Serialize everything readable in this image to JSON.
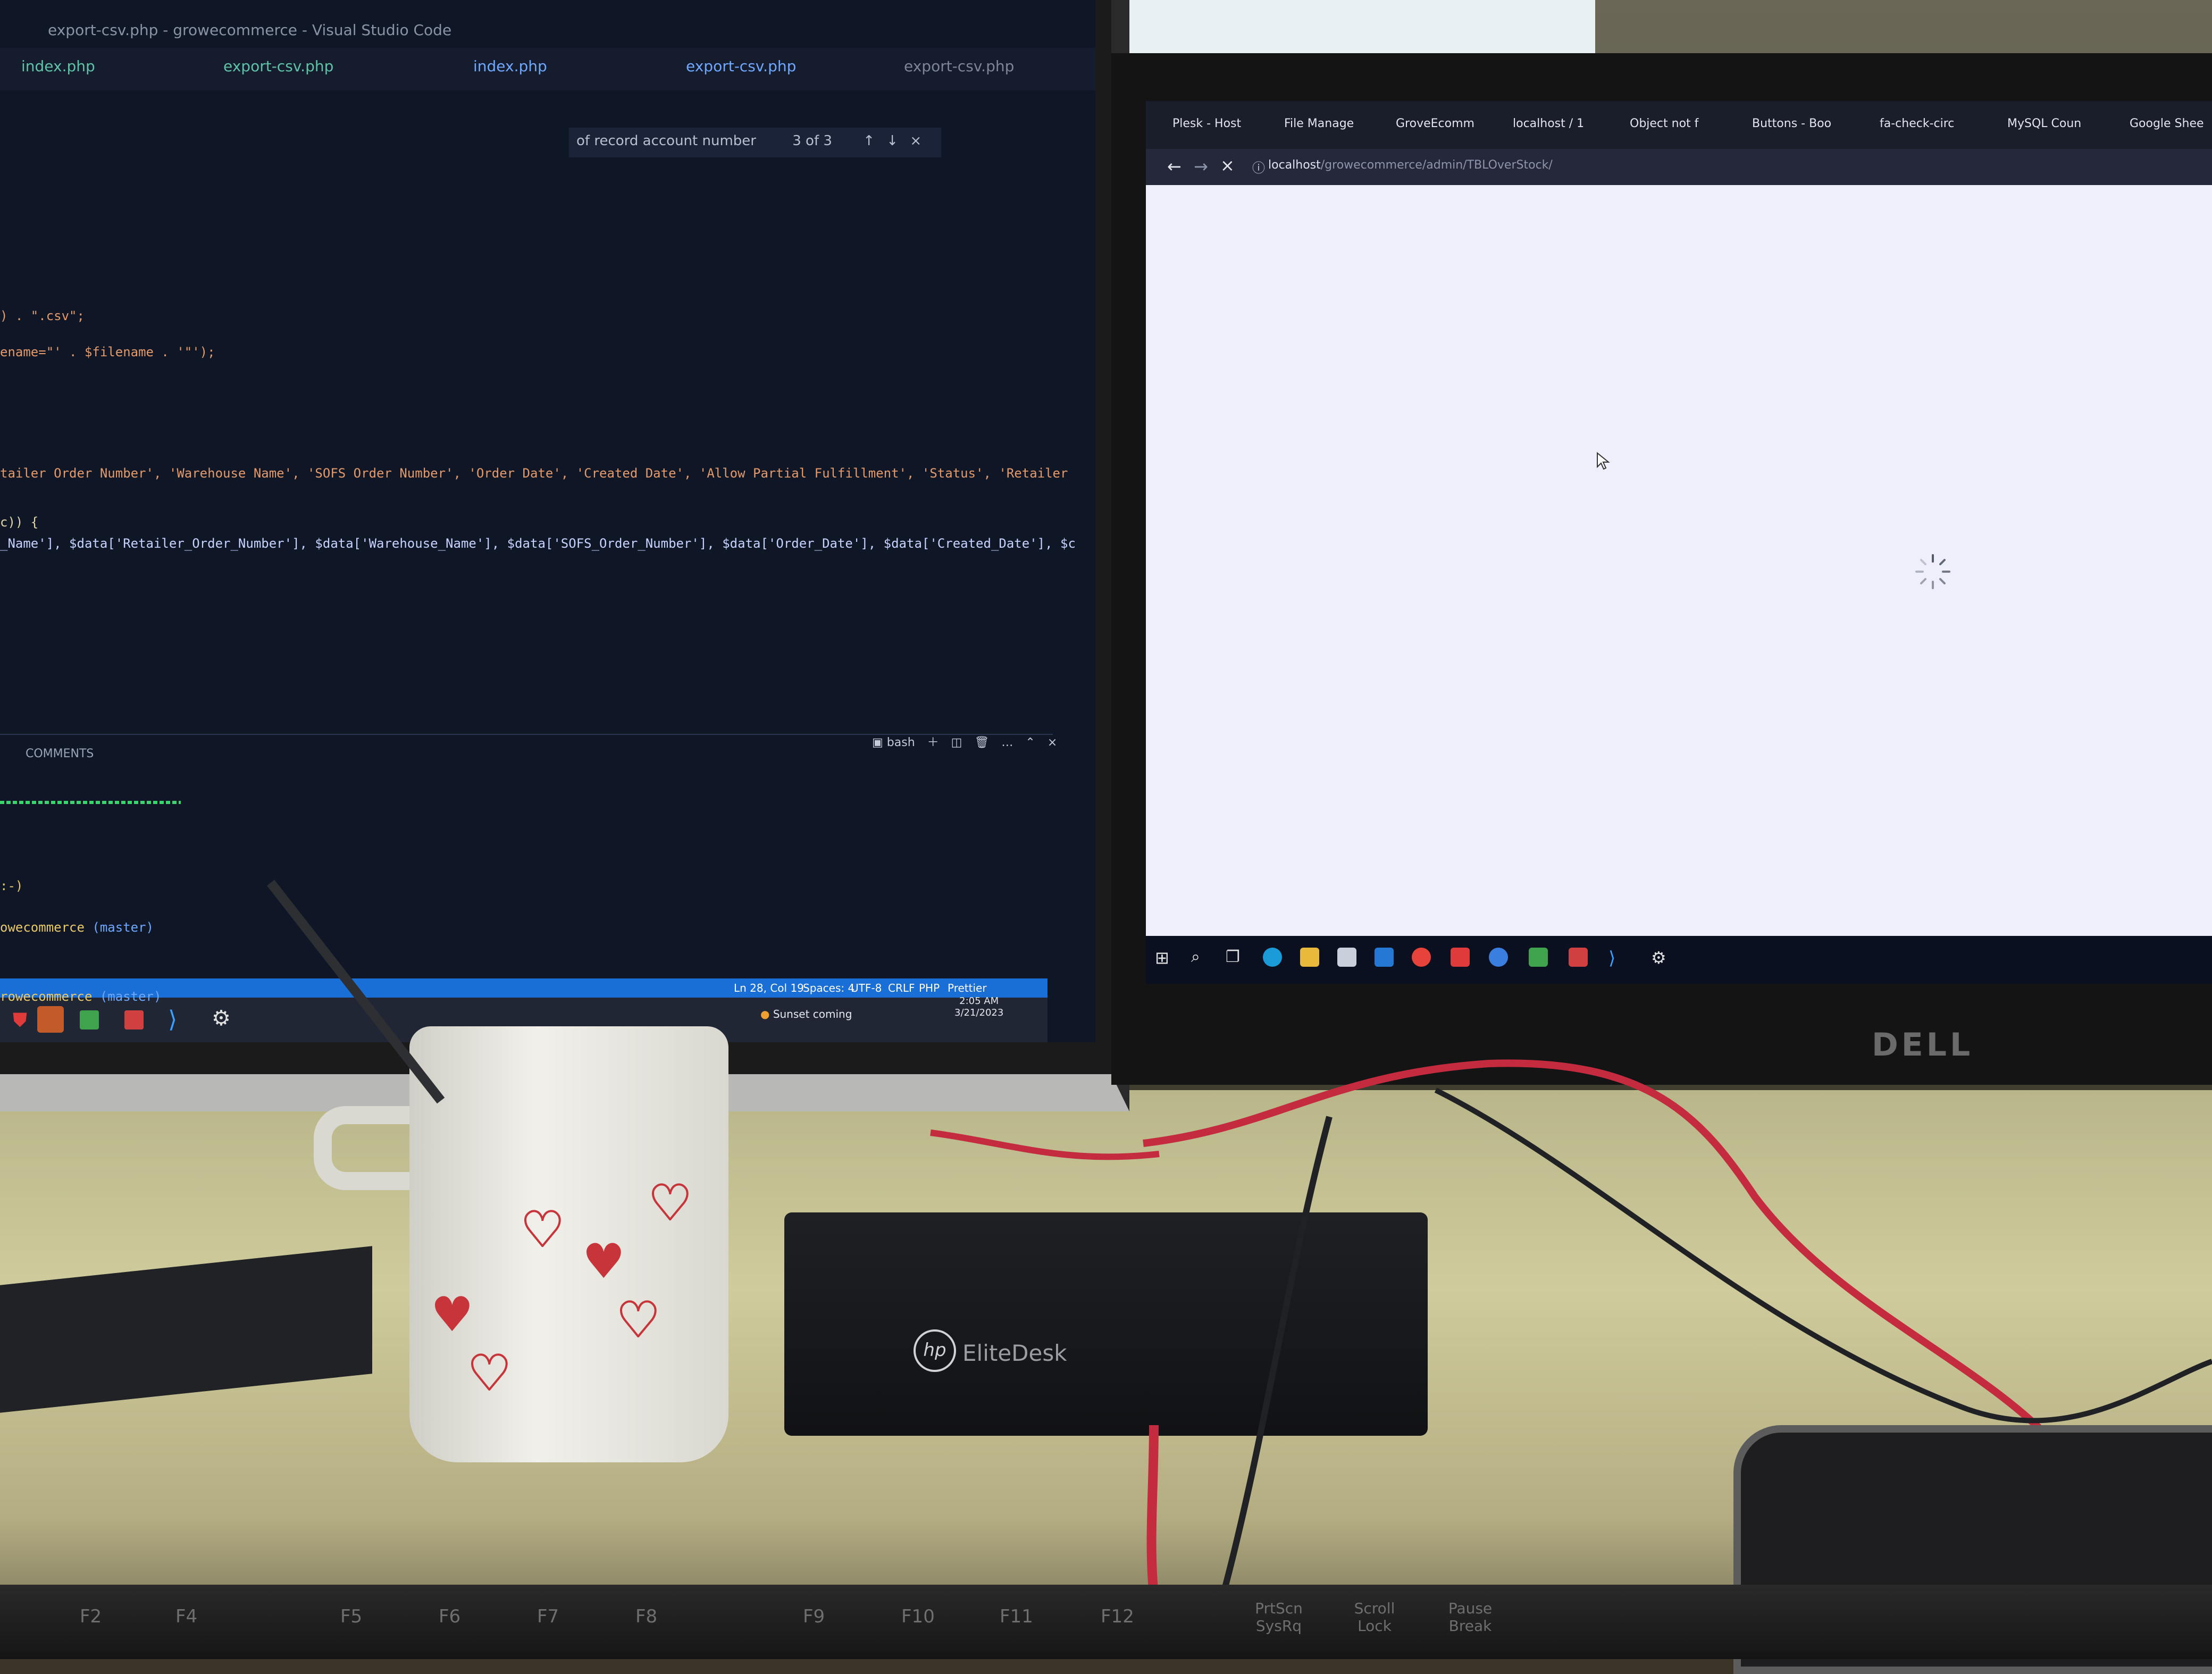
{
  "editor": {
    "title": "export-csv.php - growecommerce - Visual Studio Code",
    "tabs": [
      "index.php",
      "export-csv.php",
      "index.php",
      "export-csv.php",
      "export-csv.php"
    ],
    "find": {
      "query": "of record account number",
      "match": "3 of 3"
    },
    "code_lines": [
      ") . \".csv\";",
      "ename=\"' . $filename . '\"');",
      "tailer Order Number', 'Warehouse Name', 'SOFS Order Number', 'Order Date', 'Created Date', 'Allow Partial Fulfillment', 'Status', 'Retailer",
      "c)) {",
      "_Name'], $data['Retailer_Order_Number'], $data['Warehouse_Name'], $data['SOFS_Order_Number'], $data['Order_Date'], $data['Created_Date'], $c"
    ],
    "panel_tab": "COMMENTS",
    "terminal_label": "bash",
    "terminal_lines": [
      {
        "text": ":-)",
        "branch": ""
      },
      {
        "text": "owecommerce",
        "branch": "(master)"
      },
      {
        "text": "rowecommerce",
        "branch": "(master)"
      }
    ],
    "status": {
      "position": "Ln 28, Col 19",
      "spaces": "Spaces: 4",
      "encoding": "UTF-8",
      "eol": "CRLF",
      "language": "PHP",
      "formatter": "Prettier"
    }
  },
  "left_taskbar": {
    "weather": "Sunset coming",
    "time": "2:05 AM",
    "date": "3/21/2023"
  },
  "browser": {
    "tabs": [
      "Plesk - Host",
      "File Manage",
      "GroveEcomm",
      "localhost / 1",
      "Object not f",
      "Buttons - Boo",
      "fa-check-circ",
      "MySQL Coun",
      "Google Shee"
    ],
    "url_host": "localhost",
    "url_path": "/growecommerce/admin/TBLOverStock/"
  },
  "devices": {
    "monitor_brand": "DELL",
    "pc_brand": "hp",
    "pc_model": "EliteDesk"
  },
  "keyboard": {
    "keys": [
      "F2",
      "F4",
      "F5",
      "F6",
      "F7",
      "F8",
      "F9",
      "F10",
      "F11",
      "F12",
      "PrtScn SysRq",
      "Scroll Lock",
      "Pause Break"
    ]
  },
  "colors": {
    "editor_bg": "#0f1626",
    "status_bar": "#1a6fd6",
    "browser_bg": "#eeeffb",
    "cable": "#c42b3f"
  }
}
